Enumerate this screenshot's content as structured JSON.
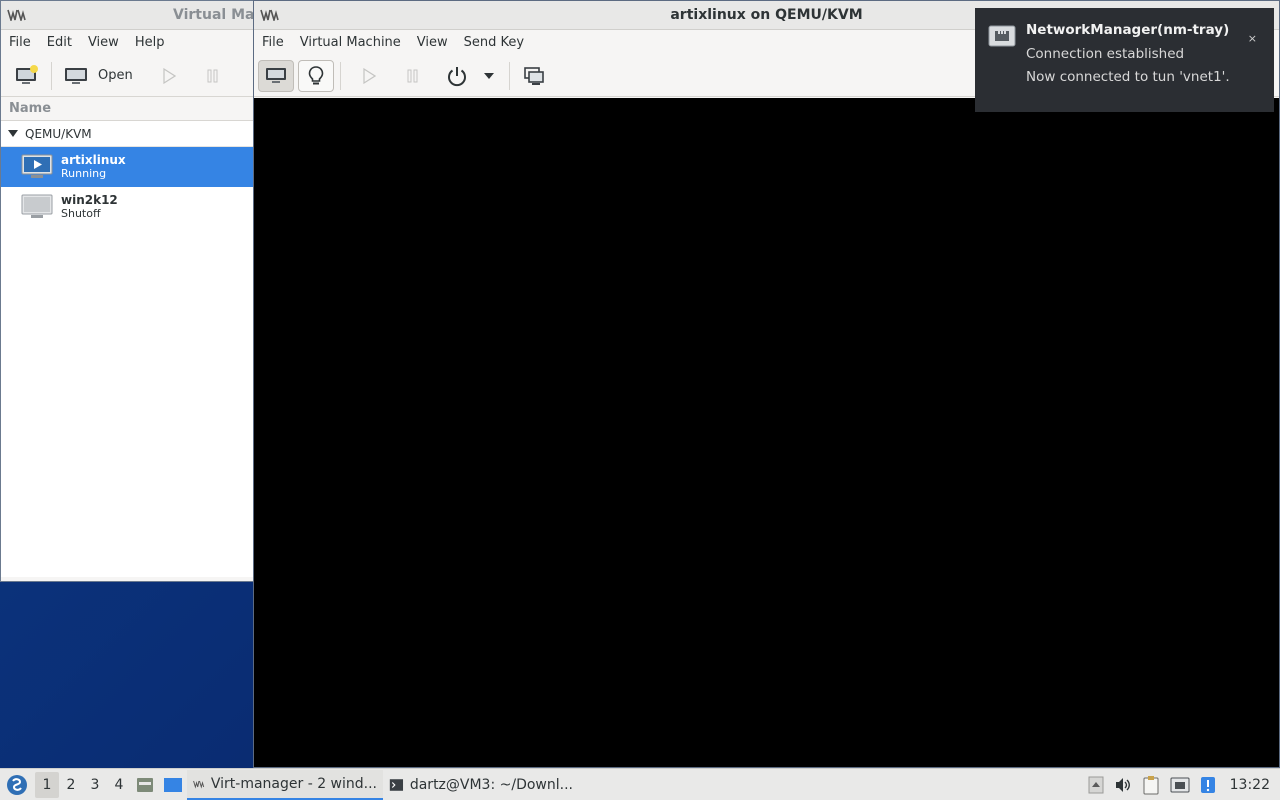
{
  "manager": {
    "title": "Virtual Machine Manager",
    "menu": [
      "File",
      "Edit",
      "View",
      "Help"
    ],
    "toolbar": {
      "open_label": "Open"
    },
    "column_header": "Name",
    "group": "QEMU/KVM",
    "vms": [
      {
        "name": "artixlinux",
        "state": "Running"
      },
      {
        "name": "win2k12",
        "state": "Shutoff"
      }
    ]
  },
  "console": {
    "title": "artixlinux on QEMU/KVM",
    "menu": [
      "File",
      "Virtual Machine",
      "View",
      "Send Key"
    ]
  },
  "notification": {
    "app": "NetworkManager(nm-tray)",
    "line1": "Connection established",
    "line2": "Now connected to tun 'vnet1'.",
    "close": "×"
  },
  "taskbar": {
    "workspaces": [
      "1",
      "2",
      "3",
      "4"
    ],
    "tasks": [
      {
        "label": "Virt-manager - 2 wind..."
      },
      {
        "label": "dartz@VM3: ~/Downl..."
      }
    ],
    "clock": "13:22"
  },
  "colors": {
    "selection": "#3584e4",
    "desktop": "#0a2d74",
    "notification_bg": "#2b2e33"
  }
}
